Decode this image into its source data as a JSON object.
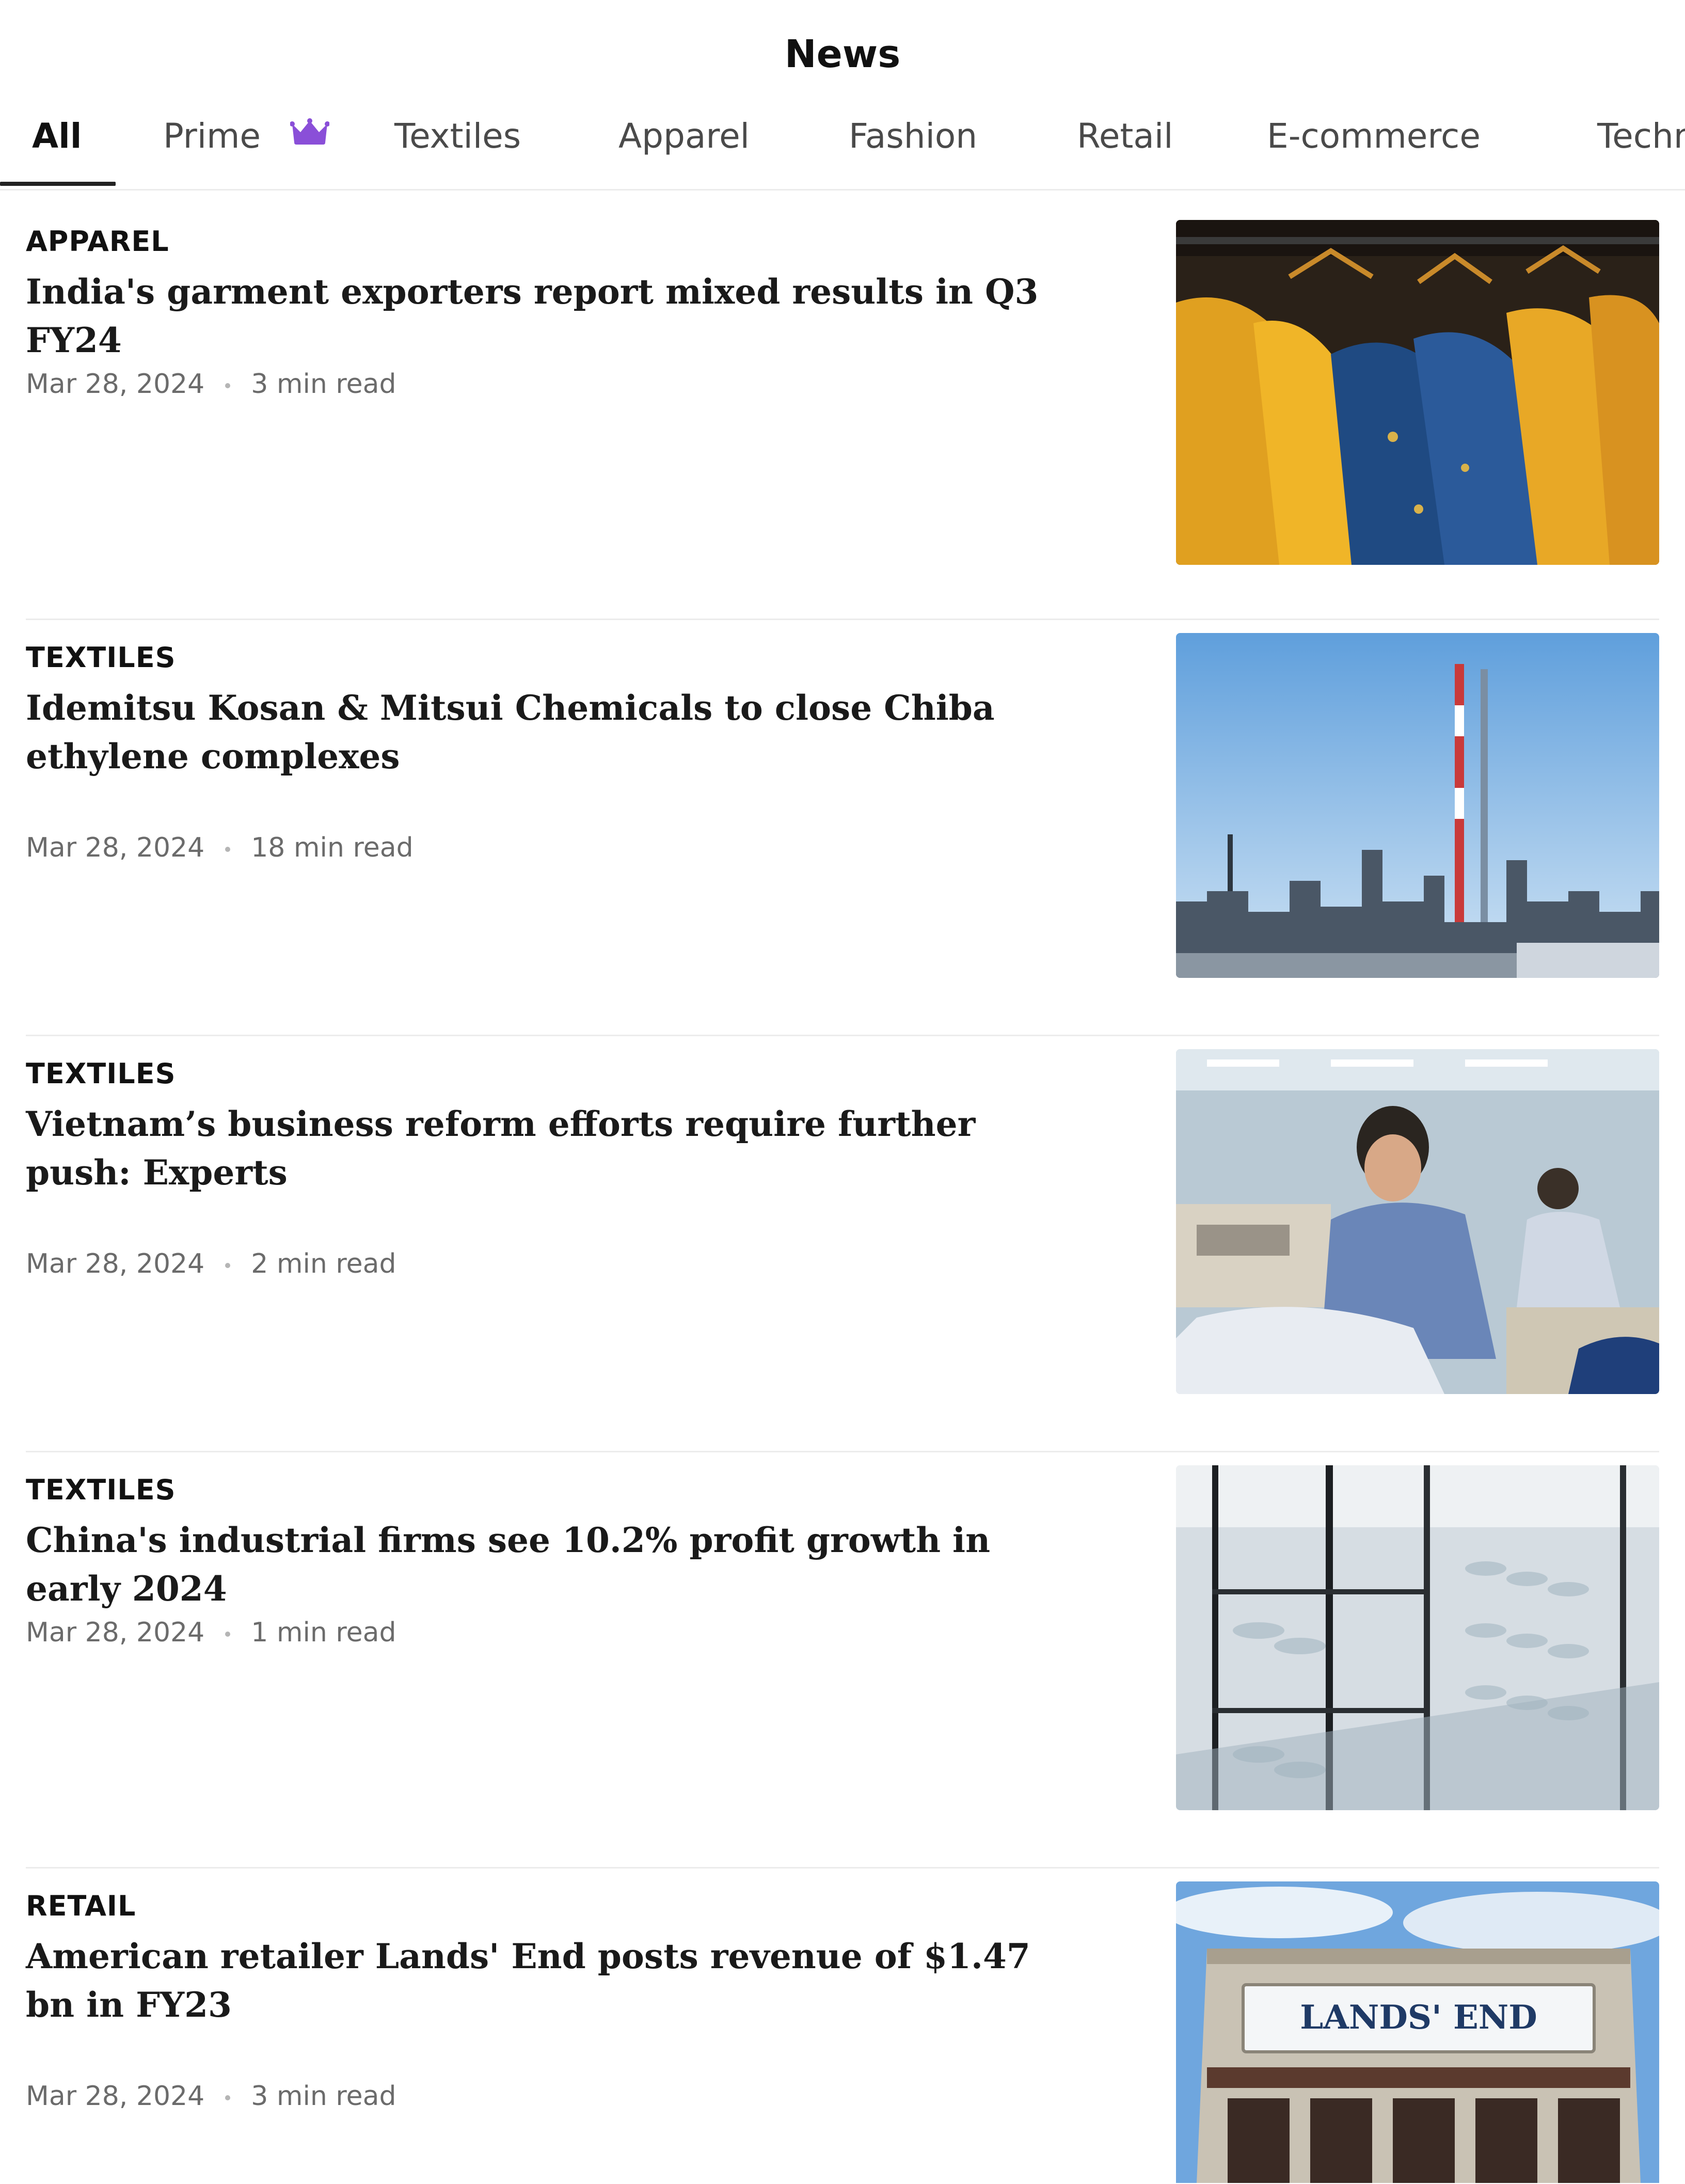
{
  "header": {
    "title": "News"
  },
  "tabs": [
    {
      "label": "All",
      "active": true
    },
    {
      "label": "Prime",
      "icon": "crown-icon",
      "icon_color": "#8a4fd8"
    },
    {
      "label": "Textiles"
    },
    {
      "label": "Apparel"
    },
    {
      "label": "Fashion"
    },
    {
      "label": "Retail"
    },
    {
      "label": "E-commerce"
    },
    {
      "label": "Techn"
    }
  ],
  "articles": [
    {
      "category": "APPAREL",
      "title": "India's garment exporters report mixed results in Q3 FY24",
      "date": "Mar 28, 2024",
      "read_time": "3 min read",
      "image": "garments-on-hangers-image"
    },
    {
      "category": "TEXTILES",
      "title": "Idemitsu Kosan & Mitsui Chemicals to close Chiba ethylene complexes",
      "date": "Mar 28, 2024",
      "read_time": "18 min read",
      "image": "industrial-plant-image"
    },
    {
      "category": "TEXTILES",
      "title": "Vietnam’s business reform efforts require further push: Experts",
      "date": "Mar 28, 2024",
      "read_time": "2 min read",
      "image": "garment-factory-worker-image"
    },
    {
      "category": "TEXTILES",
      "title": "China's industrial firms see 10.2% profit growth in early 2024",
      "date": "Mar 28, 2024",
      "read_time": "1 min read",
      "image": "textile-machinery-image"
    },
    {
      "category": "RETAIL",
      "title": "American retailer Lands' End posts revenue of $1.47 bn in FY23",
      "date": "Mar 28, 2024",
      "read_time": "3 min read",
      "image": "lands-end-storefront-image",
      "image_sign_text": "LANDS' END"
    }
  ]
}
